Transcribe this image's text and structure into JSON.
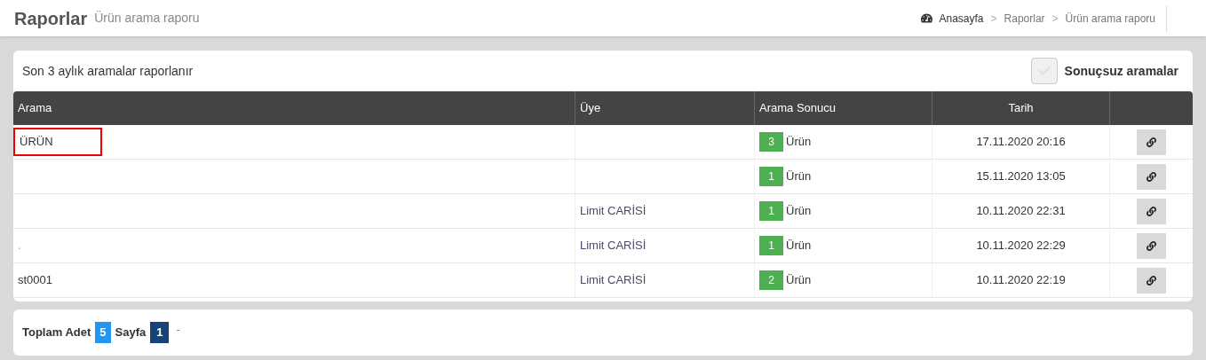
{
  "header": {
    "title": "Raporlar",
    "subtitle": "Ürün arama raporu",
    "breadcrumb": [
      "Anasayfa",
      "Raporlar",
      "Ürün arama raporu"
    ],
    "separator": ">"
  },
  "card": {
    "note": "Son 3 aylık aramalar raporlanır",
    "filter": {
      "label": "Sonuçsuz aramalar",
      "checked": false
    }
  },
  "table": {
    "columns": [
      "Arama",
      "Üye",
      "Arama Sonucu",
      "Tarih"
    ],
    "rows": [
      {
        "search": "ÜRÜN",
        "highlighted": true,
        "member": "",
        "count": "3",
        "unit": "Ürün",
        "date": "17.11.2020 20:16"
      },
      {
        "search": "",
        "highlighted": false,
        "member": "",
        "count": "1",
        "unit": "Ürün",
        "date": "15.11.2020 13:05"
      },
      {
        "search": "",
        "highlighted": false,
        "member": "Limit CARİSİ",
        "count": "1",
        "unit": "Ürün",
        "date": "10.11.2020 22:31"
      },
      {
        "search": ".",
        "highlighted": false,
        "member": "Limit CARİSİ",
        "count": "1",
        "unit": "Ürün",
        "date": "10.11.2020 22:29"
      },
      {
        "search": "st0001",
        "highlighted": false,
        "member": "Limit CARİSİ",
        "count": "2",
        "unit": "Ürün",
        "date": "10.11.2020 22:19"
      }
    ]
  },
  "footer": {
    "total_label": "Toplam Adet",
    "total": "5",
    "page_label": "Sayfa",
    "page": "1",
    "trailing": "-"
  }
}
